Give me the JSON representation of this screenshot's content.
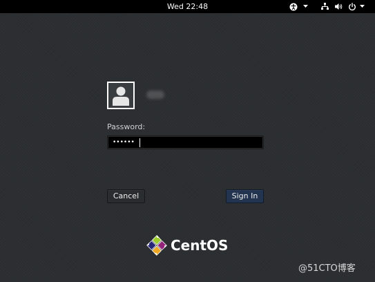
{
  "top_bar": {
    "clock": "Wed 22:48",
    "icons": [
      "accessibility-icon",
      "chevron-down-icon",
      "network-icon",
      "volume-icon",
      "power-icon",
      "chevron-down-icon"
    ]
  },
  "login": {
    "avatar_icon": "user-avatar-icon",
    "password_label": "Password:",
    "password_value": "••••••",
    "cancel_label": "Cancel",
    "signin_label": "Sign In"
  },
  "brand": {
    "logo_icon": "centos-logo-icon",
    "name": "CentOS"
  },
  "watermark": "@51CTO博客",
  "colors": {
    "background": "#2b2e30",
    "top_bar": "#000000",
    "sign_in_button": "#22344f",
    "text": "#eeeeec"
  }
}
